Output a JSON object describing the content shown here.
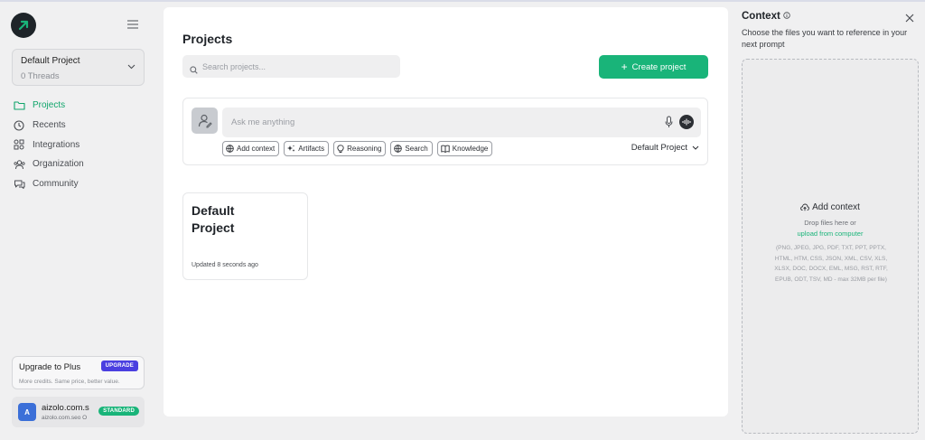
{
  "sidebar": {
    "project_selector": {
      "name": "Default Project",
      "threads": "0 Threads"
    },
    "nav": [
      {
        "label": "Projects",
        "icon": "folder-icon",
        "active": true
      },
      {
        "label": "Recents",
        "icon": "clock-icon",
        "active": false
      },
      {
        "label": "Integrations",
        "icon": "integrations-icon",
        "active": false
      },
      {
        "label": "Organization",
        "icon": "users-icon",
        "active": false
      },
      {
        "label": "Community",
        "icon": "chat-bubbles-icon",
        "active": false
      }
    ],
    "upgrade": {
      "title": "Upgrade to Plus",
      "badge": "UPGRADE",
      "subtitle": "More credits. Same price, better value."
    },
    "account": {
      "initial": "A",
      "name": "aizolo.com.s",
      "email": "aizolo.com.seo O",
      "plan": "STANDARD"
    }
  },
  "main": {
    "title": "Projects",
    "search_placeholder": "Search projects...",
    "create_button": "Create project",
    "ask": {
      "placeholder": "Ask me anything",
      "chips": [
        "Add context",
        "Artifacts",
        "Reasoning",
        "Search",
        "Knowledge"
      ],
      "project_dropdown": "Default Project"
    },
    "project_card": {
      "name": "Default Project",
      "updated": "Updated 8 seconds ago"
    }
  },
  "context_panel": {
    "title": "Context",
    "description": "Choose the files you want to reference in your next prompt",
    "add_label": "Add context",
    "drop_text": "Drop files here or",
    "upload_link": "upload from computer",
    "file_types": "(PNG, JPEG, JPG, PDF, TXT, PPT, PPTX, HTML, HTM, CSS, JSON, XML, CSV, XLS, XLSX, DOC, DOCX, EML, MSG, RST, RTF, EPUB, ODT, TSV, MD - max 32MB per file)"
  },
  "colors": {
    "accent": "#19b479",
    "upgrade_badge": "#4a3fe0",
    "avatar": "#3b6fd8"
  }
}
